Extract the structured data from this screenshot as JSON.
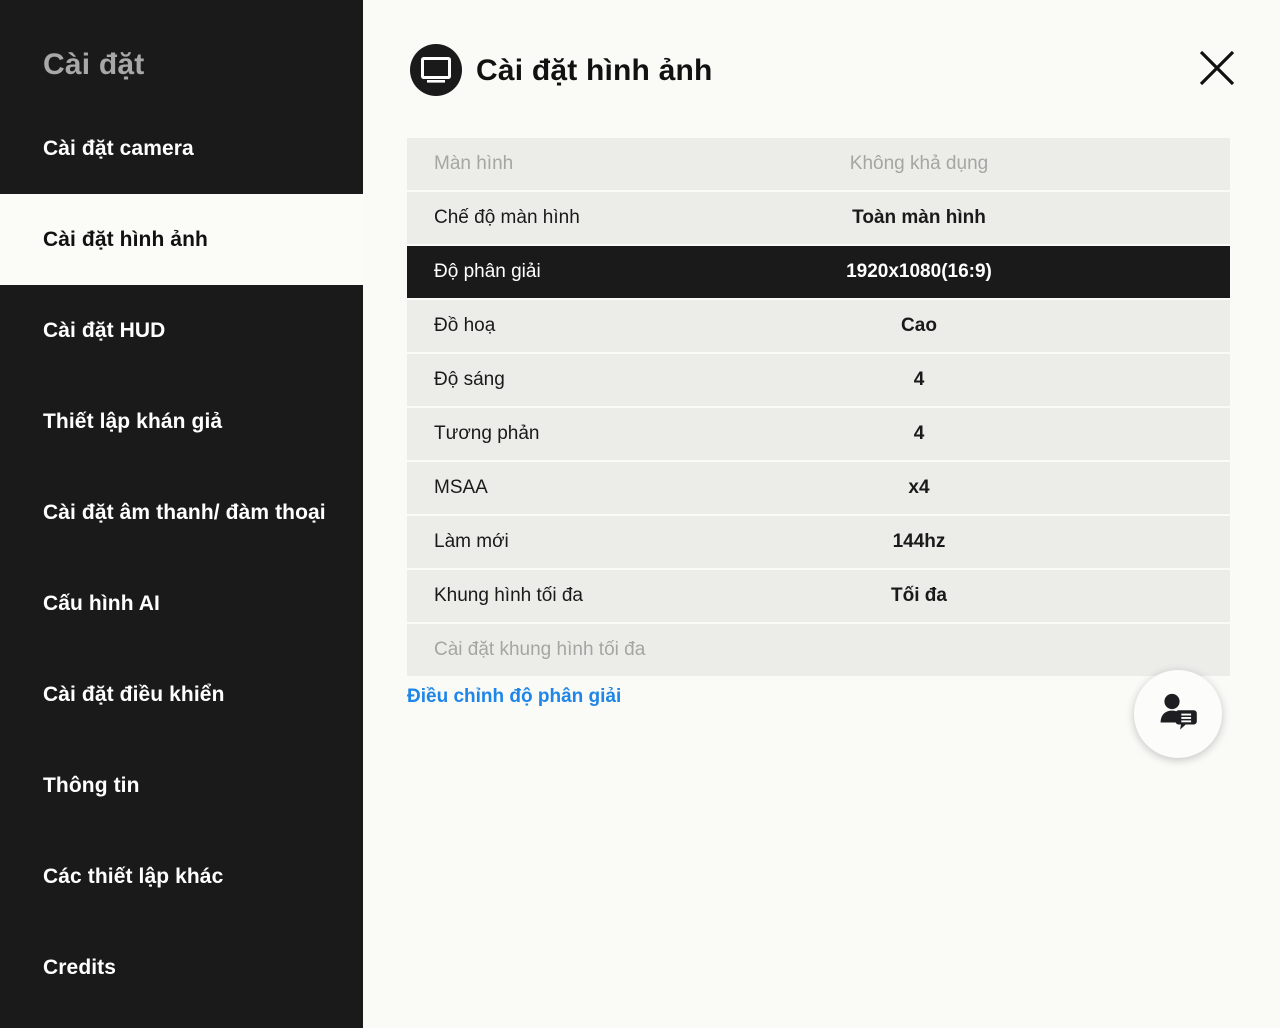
{
  "sidebar": {
    "title": "Cài đặt",
    "items": [
      {
        "label": "Cài đặt camera",
        "active": false
      },
      {
        "label": "Cài đặt hình ảnh",
        "active": true
      },
      {
        "label": "Cài đặt HUD",
        "active": false
      },
      {
        "label": "Thiết lập khán giả",
        "active": false
      },
      {
        "label": "Cài đặt âm thanh/ đàm thoại",
        "active": false
      },
      {
        "label": "Cấu hình AI",
        "active": false
      },
      {
        "label": "Cài đặt điều khiển",
        "active": false
      },
      {
        "label": "Thông tin",
        "active": false
      },
      {
        "label": "Các thiết lập khác",
        "active": false
      },
      {
        "label": "Credits",
        "active": false
      }
    ]
  },
  "header": {
    "title": "Cài đặt hình ảnh",
    "icon": "display-monitor-icon",
    "close_icon": "close-icon"
  },
  "settings": {
    "rows": [
      {
        "label": "Màn hình",
        "value": "Không khả dụng",
        "state": "disabled"
      },
      {
        "label": "Chế độ màn hình",
        "value": "Toàn màn hình",
        "state": "normal"
      },
      {
        "label": "Độ phân giải",
        "value": "1920x1080(16:9)",
        "state": "selected"
      },
      {
        "label": "Đồ hoạ",
        "value": "Cao",
        "state": "normal"
      },
      {
        "label": "Độ sáng",
        "value": "4",
        "state": "normal"
      },
      {
        "label": "Tương phản",
        "value": "4",
        "state": "normal"
      },
      {
        "label": "MSAA",
        "value": "x4",
        "state": "normal"
      },
      {
        "label": "Làm mới",
        "value": "144hz",
        "state": "normal"
      },
      {
        "label": "Khung hình tối đa",
        "value": "Tối đa",
        "state": "normal"
      },
      {
        "label": "Cài đặt khung hình tối đa",
        "value": "",
        "state": "disabled"
      }
    ]
  },
  "footer": {
    "resolution_link": "Điều chỉnh độ phân giải"
  },
  "support": {
    "icon": "person-chat-icon"
  },
  "colors": {
    "sidebar_bg": "#1A1A1A",
    "panel_bg": "#FAFAF6",
    "row_bg": "#ECECE9",
    "selected_bg": "#1A1A1A",
    "link": "#1E86E8",
    "muted_text": "#A5A5A2",
    "sidebar_title": "#A8A8A8"
  }
}
